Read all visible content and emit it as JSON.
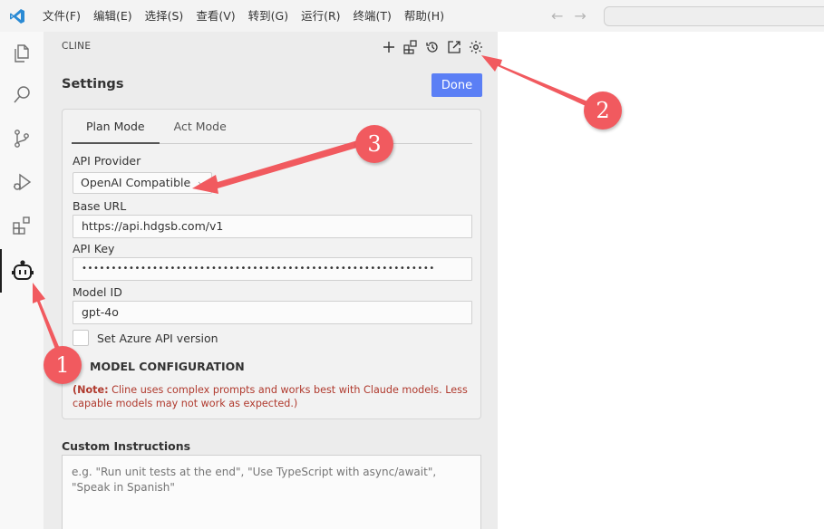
{
  "menu": {
    "items": [
      "文件(F)",
      "编辑(E)",
      "选择(S)",
      "查看(V)",
      "转到(G)",
      "运行(R)",
      "终端(T)",
      "帮助(H)"
    ]
  },
  "sidebar": {
    "header": "CLINE",
    "settings_title": "Settings",
    "done_label": "Done"
  },
  "tabs": [
    {
      "label": "Plan Mode",
      "active": true
    },
    {
      "label": "Act Mode",
      "active": false
    }
  ],
  "api_provider": {
    "label": "API Provider",
    "value": "OpenAI Compatible"
  },
  "base_url": {
    "label": "Base URL",
    "value": "https://api.hdgsb.com/v1"
  },
  "api_key": {
    "label": "API Key",
    "value": "••••••••••••••••••••••••••••••••••••••••••••••••••••••••••••"
  },
  "model_id": {
    "label": "Model ID",
    "value": "gpt-4o"
  },
  "azure": {
    "label": "Set Azure API version",
    "checked": false
  },
  "model_config": {
    "label": "MODEL CONFIGURATION"
  },
  "note": {
    "prefix": "(Note:",
    "text": " Cline uses complex prompts and works best with Claude models. Less capable models may not work as expected.)"
  },
  "custom_instructions": {
    "label": "Custom Instructions",
    "placeholder": "e.g. \"Run unit tests at the end\", \"Use TypeScript with async/await\", \"Speak in Spanish\""
  },
  "annotations": [
    "1",
    "2",
    "3"
  ],
  "colors": {
    "accent": "#5b7ff5",
    "annotation": "#f15a5f",
    "note": "#b03a2e"
  }
}
